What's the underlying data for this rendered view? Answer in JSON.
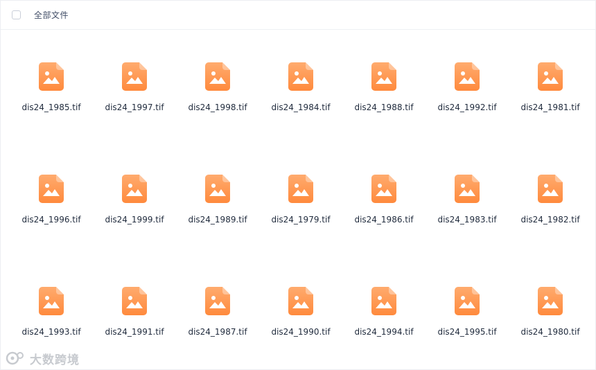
{
  "header": {
    "title": "全部文件"
  },
  "files": [
    "dis24_1985.tif",
    "dis24_1997.tif",
    "dis24_1998.tif",
    "dis24_1984.tif",
    "dis24_1988.tif",
    "dis24_1992.tif",
    "dis24_1981.tif",
    "dis24_1996.tif",
    "dis24_1999.tif",
    "dis24_1989.tif",
    "dis24_1979.tif",
    "dis24_1986.tif",
    "dis24_1983.tif",
    "dis24_1982.tif",
    "dis24_1993.tif",
    "dis24_1991.tif",
    "dis24_1987.tif",
    "dis24_1990.tif",
    "dis24_1994.tif",
    "dis24_1995.tif",
    "dis24_1980.tif"
  ],
  "icon": {
    "name": "image-file-icon",
    "color_top": "#ffab6e",
    "color_bottom": "#ff8a3d"
  },
  "watermark": {
    "text": "大数跨境"
  }
}
